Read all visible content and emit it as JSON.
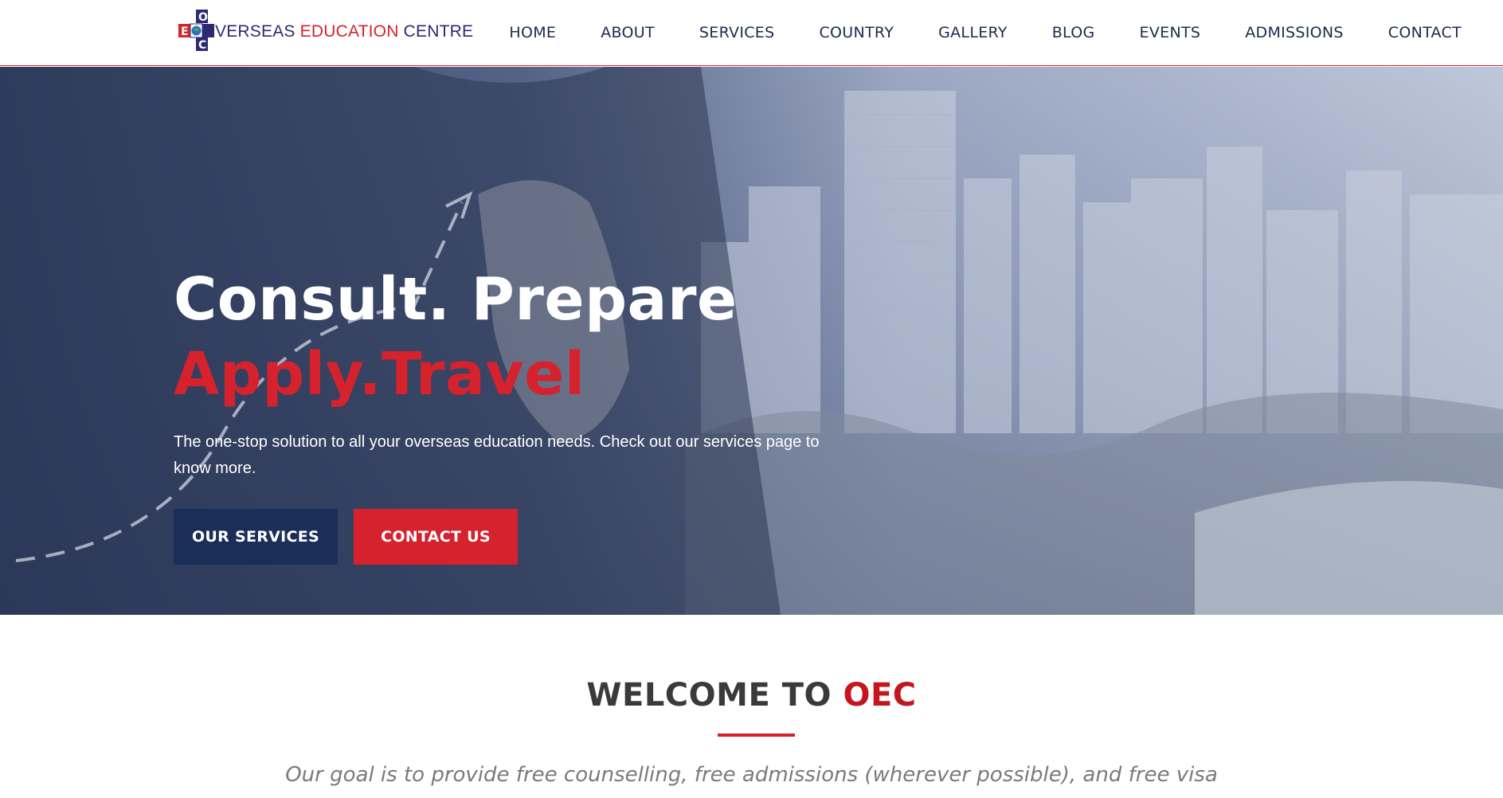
{
  "header": {
    "logo": {
      "letters": [
        "E",
        "O",
        "C"
      ],
      "text_primary": "VERSEAS",
      "text_secondary": "EDUCATION",
      "text_tertiary": "CENTRE"
    },
    "nav": [
      {
        "label": "HOME"
      },
      {
        "label": "ABOUT"
      },
      {
        "label": "SERVICES"
      },
      {
        "label": "COUNTRY"
      },
      {
        "label": "GALLERY"
      },
      {
        "label": "BLOG"
      },
      {
        "label": "EVENTS"
      },
      {
        "label": "ADMISSIONS"
      },
      {
        "label": "CONTACT"
      }
    ]
  },
  "hero": {
    "title_line1": "Consult. Prepare",
    "title_line2": "Apply.Travel",
    "description": "The one-stop solution to all your overseas education needs. Check out our services page to know more.",
    "buttons": {
      "services": "OUR SERVICES",
      "contact": "CONTACT US"
    }
  },
  "welcome": {
    "title_prefix": "WELCOME TO ",
    "title_highlight": "OEC",
    "text": "Our goal is to provide free counselling, free admissions (wherever possible), and free visa"
  },
  "colors": {
    "brand_navy": "#1b2e58",
    "brand_red": "#d6222c",
    "nav_text": "#1d2b4c"
  }
}
